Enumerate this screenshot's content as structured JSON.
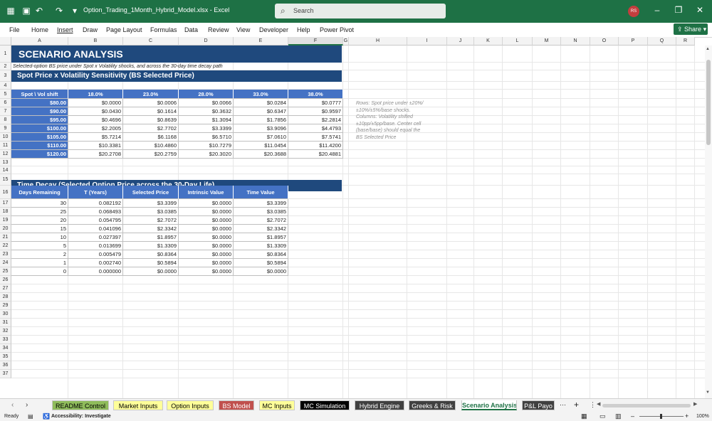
{
  "window": {
    "filename": "Option_Trading_1Month_Hybrid_Model.xlsx",
    "app": "Excel",
    "search_placeholder": "Search",
    "user_initials": "RS"
  },
  "ribbon": {
    "menus": [
      "File",
      "Home",
      "Insert",
      "Draw",
      "Page Layout",
      "Formulas",
      "Data",
      "Review",
      "View",
      "Developer",
      "Help",
      "Power Pivot"
    ],
    "share_label": "Share"
  },
  "columns": [
    "A",
    "B",
    "C",
    "D",
    "E",
    "F",
    "G",
    "H",
    "I",
    "J",
    "K",
    "L",
    "M",
    "N",
    "O",
    "P",
    "Q",
    "R"
  ],
  "rows": [
    "1",
    "2",
    "3",
    "4",
    "5",
    "6",
    "7",
    "8",
    "9",
    "10",
    "11",
    "12",
    "13",
    "14",
    "15",
    "16",
    "17",
    "18",
    "19",
    "20",
    "21",
    "22",
    "23",
    "24",
    "25",
    "26",
    "27",
    "28",
    "29",
    "30",
    "31",
    "32",
    "33",
    "34",
    "35",
    "36",
    "37"
  ],
  "sheet": {
    "title": "SCENARIO ANALYSIS",
    "subtitle": "Selected-option BS price under Spot x Volatility shocks, and across the 30-day time decay path",
    "section1_title": "Spot Price x Volatility Sensitivity  (BS Selected Price)",
    "grid_header": [
      "Spot \\ Vol shift",
      "18.0%",
      "23.0%",
      "28.0%",
      "33.0%",
      "38.0%"
    ],
    "grid_rows": [
      {
        "spot": "$80.00",
        "v": [
          "$0.0000",
          "$0.0006",
          "$0.0066",
          "$0.0284",
          "$0.0777"
        ]
      },
      {
        "spot": "$90.00",
        "v": [
          "$0.0430",
          "$0.1614",
          "$0.3632",
          "$0.6347",
          "$0.9597"
        ]
      },
      {
        "spot": "$95.00",
        "v": [
          "$0.4696",
          "$0.8639",
          "$1.3094",
          "$1.7856",
          "$2.2814"
        ]
      },
      {
        "spot": "$100.00",
        "v": [
          "$2.2005",
          "$2.7702",
          "$3.3399",
          "$3.9096",
          "$4.4793"
        ]
      },
      {
        "spot": "$105.00",
        "v": [
          "$5.7214",
          "$6.1168",
          "$6.5710",
          "$7.0610",
          "$7.5741"
        ]
      },
      {
        "spot": "$110.00",
        "v": [
          "$10.3381",
          "$10.4860",
          "$10.7279",
          "$11.0454",
          "$11.4200"
        ]
      },
      {
        "spot": "$120.00",
        "v": [
          "$20.2708",
          "$20.2759",
          "$20.3020",
          "$20.3688",
          "$20.4881"
        ]
      }
    ],
    "note": "Rows: Spot price under ±20%/±10%/±5%/base shocks. Columns: Volatility shifted ±10pp/±5pp/base. Center cell (base/base) should equal the BS Selected Price",
    "section2_title": "Time Decay  (Selected Option Price across the 30-Day Life)",
    "decay_header": [
      "Days Remaining",
      "T (Years)",
      "Selected Price",
      "Intrinsic Value",
      "Time Value"
    ],
    "decay_rows": [
      [
        "30",
        "0.082192",
        "$3.3399",
        "$0.0000",
        "$3.3399"
      ],
      [
        "25",
        "0.068493",
        "$3.0385",
        "$0.0000",
        "$3.0385"
      ],
      [
        "20",
        "0.054795",
        "$2.7072",
        "$0.0000",
        "$2.7072"
      ],
      [
        "15",
        "0.041096",
        "$2.3342",
        "$0.0000",
        "$2.3342"
      ],
      [
        "10",
        "0.027397",
        "$1.8957",
        "$0.0000",
        "$1.8957"
      ],
      [
        "5",
        "0.013699",
        "$1.3309",
        "$0.0000",
        "$1.3309"
      ],
      [
        "2",
        "0.005479",
        "$0.8364",
        "$0.0000",
        "$0.8364"
      ],
      [
        "1",
        "0.002740",
        "$0.5894",
        "$0.0000",
        "$0.5894"
      ],
      [
        "0",
        "0.000000",
        "$0.0000",
        "$0.0000",
        "$0.0000"
      ]
    ]
  },
  "tabs": [
    {
      "label": "README Control",
      "bg": "#8fbc5b",
      "fg": "#000000"
    },
    {
      "label": "Market Inputs",
      "bg": "#ffff99",
      "fg": "#000000"
    },
    {
      "label": "Option Inputs",
      "bg": "#ffff99",
      "fg": "#000000"
    },
    {
      "label": "BS Model",
      "bg": "#c0504d",
      "fg": "#ffffff"
    },
    {
      "label": "MC Inputs",
      "bg": "#ffff99",
      "fg": "#000000"
    },
    {
      "label": "MC Simulation",
      "bg": "#000000",
      "fg": "#ffffff"
    },
    {
      "label": "Hybrid Engine",
      "bg": "#404040",
      "fg": "#ffffff"
    },
    {
      "label": "Greeks & Risk",
      "bg": "#404040",
      "fg": "#ffffff"
    },
    {
      "label": "Scenario Analysis",
      "bg": "#ffffff",
      "fg": "#000000"
    },
    {
      "label": "P&L Payo",
      "bg": "#404040",
      "fg": "#ffffff"
    }
  ],
  "status": {
    "ready": "Ready",
    "accessibility": "Accessibility: Investigate",
    "zoom": "100%"
  },
  "colors": {
    "excel_green": "#1e7145",
    "title_band": "#1f497d",
    "header_blue": "#4472c4"
  }
}
